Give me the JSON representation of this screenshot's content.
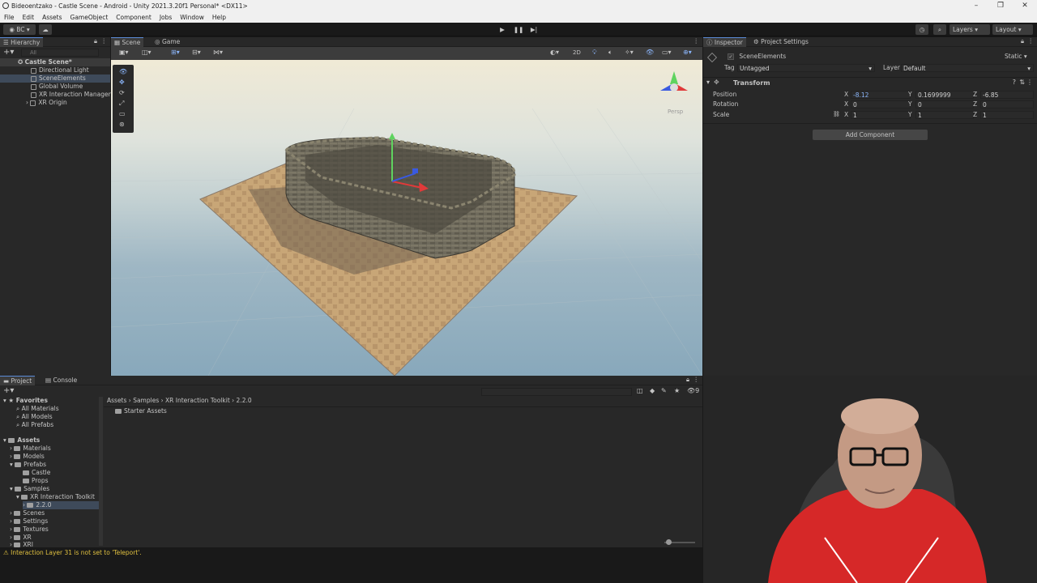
{
  "window": {
    "title": "Bideoentzako - Castle Scene - Android - Unity 2021.3.20f1 Personal* <DX11>"
  },
  "menu": [
    "File",
    "Edit",
    "Assets",
    "GameObject",
    "Component",
    "Jobs",
    "Window",
    "Help"
  ],
  "toolbar": {
    "account": "BC",
    "layers_label": "Layers",
    "layout_label": "Layout"
  },
  "hierarchy": {
    "tab": "Hierarchy",
    "search_placeholder": "All",
    "items": [
      {
        "label": "Castle Scene*",
        "depth": 0
      },
      {
        "label": "Directional Light",
        "depth": 1
      },
      {
        "label": "SceneElements",
        "depth": 1
      },
      {
        "label": "Global Volume",
        "depth": 1
      },
      {
        "label": "XR Interaction Manager",
        "depth": 1
      },
      {
        "label": "XR Origin",
        "depth": 1
      }
    ]
  },
  "scene": {
    "tabs": [
      "Scene",
      "Game"
    ],
    "mode_2d": "2D",
    "persp_label": "Persp"
  },
  "inspector": {
    "tabs": [
      "Inspector",
      "Project Settings"
    ],
    "object_name": "SceneElements",
    "static_label": "Static",
    "tag_label": "Tag",
    "tag_value": "Untagged",
    "layer_label": "Layer",
    "layer_value": "Default",
    "component": "Transform",
    "position": {
      "label": "Position",
      "x": "-8.12",
      "y": "0.1699999",
      "z": "-6.85"
    },
    "rotation": {
      "label": "Rotation",
      "x": "0",
      "y": "0",
      "z": "0"
    },
    "scale": {
      "label": "Scale",
      "x": "1",
      "y": "1",
      "z": "1"
    },
    "axis_x": "X",
    "axis_y": "Y",
    "axis_z": "Z",
    "add_component": "Add Component"
  },
  "project": {
    "tabs": [
      "Project",
      "Console"
    ],
    "favorites_label": "Favorites",
    "favorites": [
      "All Materials",
      "All Models",
      "All Prefabs"
    ],
    "assets_label": "Assets",
    "tree": [
      {
        "label": "Materials",
        "depth": 1
      },
      {
        "label": "Models",
        "depth": 1
      },
      {
        "label": "Prefabs",
        "depth": 1
      },
      {
        "label": "Castle",
        "depth": 2
      },
      {
        "label": "Props",
        "depth": 2
      },
      {
        "label": "Samples",
        "depth": 1
      },
      {
        "label": "XR Interaction Toolkit",
        "depth": 2
      },
      {
        "label": "2.2.0",
        "depth": 3
      },
      {
        "label": "Scenes",
        "depth": 1
      },
      {
        "label": "Settings",
        "depth": 1
      },
      {
        "label": "Textures",
        "depth": 1
      },
      {
        "label": "XR",
        "depth": 1
      },
      {
        "label": "XRI",
        "depth": 1
      }
    ],
    "breadcrumb": [
      "Assets",
      "Samples",
      "XR Interaction Toolkit",
      "2.2.0"
    ],
    "folder_contents": [
      "Starter Assets"
    ],
    "hidden_count": "9"
  },
  "status": {
    "message": "Interaction Layer 31 is not set to 'Teleport'."
  },
  "colors": {
    "accent": "#3e4a5a",
    "warning": "#e0c040"
  }
}
